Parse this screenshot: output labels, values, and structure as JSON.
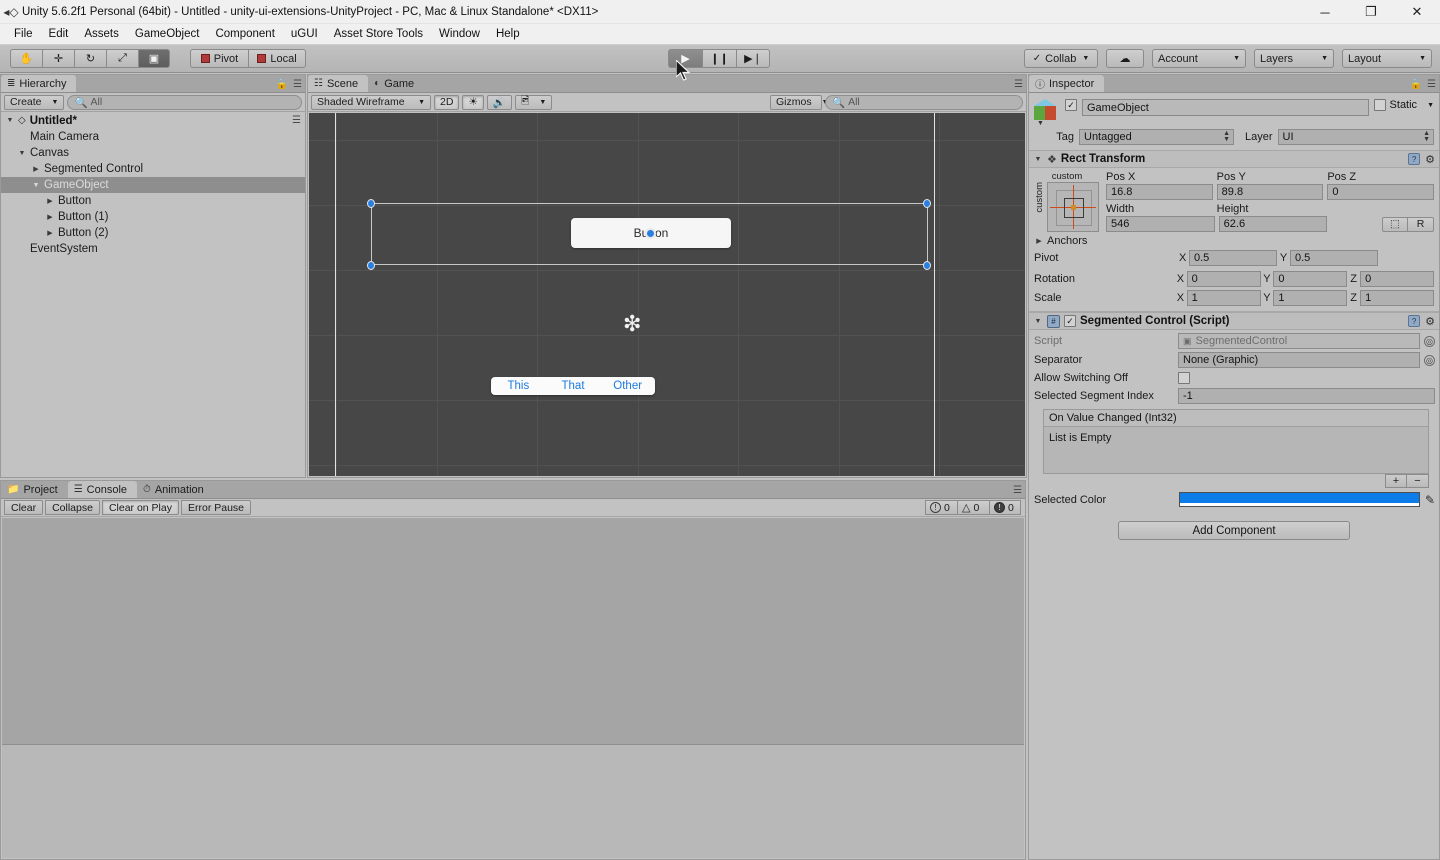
{
  "window": {
    "title": "Unity 5.6.2f1 Personal (64bit) - Untitled - unity-ui-extensions-UnityProject - PC, Mac & Linux Standalone* <DX11>",
    "icon": "unity-logo-icon",
    "minimize": "─",
    "maximize": "❐",
    "close": "✕"
  },
  "menu": {
    "items": [
      "File",
      "Edit",
      "Assets",
      "GameObject",
      "Component",
      "uGUI",
      "Asset Store Tools",
      "Window",
      "Help"
    ]
  },
  "toolbar": {
    "tools": [
      {
        "name": "hand-tool",
        "glyph": "✋"
      },
      {
        "name": "move-tool",
        "glyph": "✛"
      },
      {
        "name": "rotate-tool",
        "glyph": "↻"
      },
      {
        "name": "scale-tool",
        "glyph": "⤢"
      },
      {
        "name": "rect-tool",
        "glyph": "▣"
      }
    ],
    "pivot_label": "Pivot",
    "local_label": "Local",
    "play_label": "▶",
    "pause_label": "❙❙",
    "step_label": "▶❘",
    "collab_label": "Collab",
    "cloud_label": "☁",
    "account_label": "Account",
    "layers_label": "Layers",
    "layout_label": "Layout"
  },
  "hierarchy": {
    "tab_label": "Hierarchy",
    "tab_icon": "hierarchy-icon",
    "create_label": "Create",
    "search_placeholder": "All",
    "scene_name": "Untitled*",
    "items": [
      {
        "label": "Main Camera",
        "depth": 1,
        "arrow": "",
        "selected": false
      },
      {
        "label": "Canvas",
        "depth": 1,
        "arrow": "▼",
        "selected": false
      },
      {
        "label": "Segmented Control",
        "depth": 2,
        "arrow": "▶",
        "selected": false
      },
      {
        "label": "GameObject",
        "depth": 2,
        "arrow": "▼",
        "selected": true
      },
      {
        "label": "Button",
        "depth": 3,
        "arrow": "▶",
        "selected": false
      },
      {
        "label": "Button (1)",
        "depth": 3,
        "arrow": "▶",
        "selected": false
      },
      {
        "label": "Button (2)",
        "depth": 3,
        "arrow": "▶",
        "selected": false
      },
      {
        "label": "EventSystem",
        "depth": 1,
        "arrow": "",
        "selected": false
      }
    ]
  },
  "scene": {
    "tabs": [
      {
        "label": "Scene",
        "icon": "grid-icon",
        "active": true
      },
      {
        "label": "Game",
        "icon": "gamepad-icon",
        "active": false
      }
    ],
    "draw_mode": "Shaded Wireframe",
    "mode_2d": "2D",
    "lighting_icon": "☀",
    "audio_icon": "🔊",
    "fx_icon": "⛰",
    "gizmos_label": "Gizmos",
    "search_placeholder": "All",
    "button_label": "Button",
    "segments": [
      "This",
      "That",
      "Other"
    ]
  },
  "inspector": {
    "tab_label": "Inspector",
    "tab_icon": "info-icon",
    "object_name": "GameObject",
    "static_label": "Static",
    "tag_label": "Tag",
    "tag_value": "Untagged",
    "layer_label": "Layer",
    "layer_value": "UI",
    "rect_transform": {
      "title": "Rect Transform",
      "anchor_preset_top": "custom",
      "anchor_preset_side": "custom",
      "pos_x_label": "Pos X",
      "pos_x": "16.8",
      "pos_y_label": "Pos Y",
      "pos_y": "89.8",
      "pos_z_label": "Pos Z",
      "pos_z": "0",
      "width_label": "Width",
      "width": "546",
      "height_label": "Height",
      "height": "62.6",
      "blueprint_btn": "⬚",
      "raw_btn": "R",
      "anchors_label": "Anchors",
      "pivot_label": "Pivot",
      "pivot_x": "0.5",
      "pivot_y": "0.5",
      "rotation_label": "Rotation",
      "rot_x": "0",
      "rot_y": "0",
      "rot_z": "0",
      "scale_label": "Scale",
      "scale_x": "1",
      "scale_y": "1",
      "scale_z": "1"
    },
    "segmented_control": {
      "title": "Segmented Control (Script)",
      "script_label": "Script",
      "script_value": "SegmentedControl",
      "separator_label": "Separator",
      "separator_value": "None (Graphic)",
      "allow_switching_off_label": "Allow Switching Off",
      "selected_index_label": "Selected Segment Index",
      "selected_index_value": "-1",
      "event_header": "On Value Changed (Int32)",
      "event_empty": "List is Empty",
      "add_btn": "+",
      "remove_btn": "−",
      "selected_color_label": "Selected Color",
      "selected_color_value": "#0C7CE8"
    },
    "add_component_label": "Add Component"
  },
  "console": {
    "tabs": [
      {
        "label": "Project",
        "icon": "folder-icon",
        "active": false
      },
      {
        "label": "Console",
        "icon": "console-icon",
        "active": true
      },
      {
        "label": "Animation",
        "icon": "clock-icon",
        "active": false
      }
    ],
    "clear_label": "Clear",
    "collapse_label": "Collapse",
    "clear_on_play_label": "Clear on Play",
    "error_pause_label": "Error Pause",
    "info_count": "0",
    "warning_count": "0",
    "error_count": "0"
  }
}
